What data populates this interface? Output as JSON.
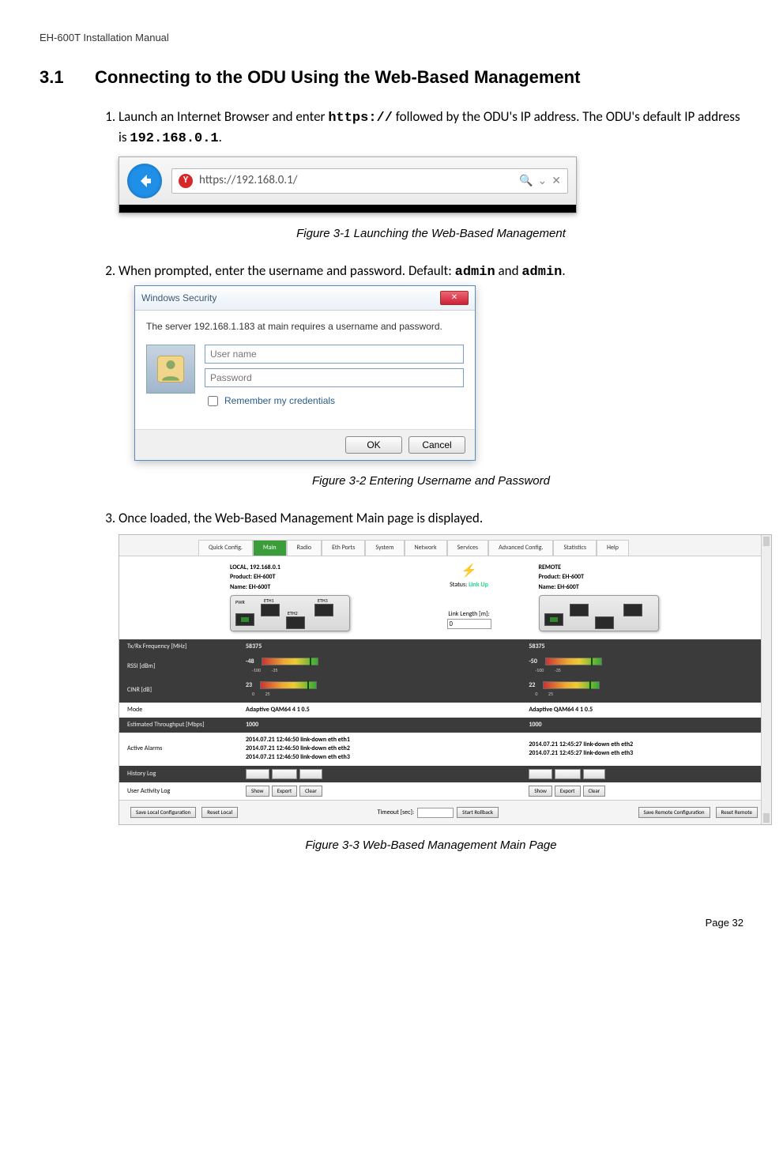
{
  "header": "EH-600T Installation Manual",
  "section": {
    "num": "3.1",
    "title": "Connecting to the ODU Using the Web-Based Management"
  },
  "steps": {
    "s1a": "Launch an Internet Browser and enter ",
    "s1_code1": "https://",
    "s1b": " followed by the ODU's IP address. The ODU's default IP address is ",
    "s1_code2": "192.168.0.1",
    "s1c": ".",
    "s2a": "When prompted, enter the username and password. Default: ",
    "s2_code1": "admin",
    "s2b": " and ",
    "s2_code2": "admin",
    "s2c": ".",
    "s3": "Once loaded, the Web-Based Management Main page is displayed."
  },
  "captions": {
    "f1": "Figure 3-1 Launching the Web-Based Management",
    "f2": "Figure 3-2 Entering Username and Password",
    "f3": "Figure 3-3 Web-Based Management Main Page"
  },
  "browser": {
    "url": "https://192.168.0.1/",
    "search_hint": "⌄",
    "close": "✕",
    "mag": "🔍"
  },
  "dialog": {
    "title": "Windows Security",
    "msg": "The server 192.168.1.183 at main requires a username and password.",
    "user_ph": "User name",
    "pass_ph": "Password",
    "remember": "Remember my credentials",
    "ok": "OK",
    "cancel": "Cancel"
  },
  "mgmt": {
    "tabs": [
      "Quick Config.",
      "Main",
      "Radio",
      "Eth Ports",
      "System",
      "Network",
      "Services",
      "Advanced Config.",
      "Statistics",
      "Help"
    ],
    "local": {
      "heading": "LOCAL, 192.168.0.1",
      "product": "Product: EH-600T",
      "name": "Name: EH-600T"
    },
    "remote": {
      "heading": "REMOTE",
      "product": "Product: EH-600T",
      "name": "Name: EH-600T"
    },
    "status_label": "Status:",
    "status_value": "Link Up",
    "link_len": "Link Length [m]:",
    "link_len_val": "0",
    "rows": [
      {
        "label": "Tx/Rx Frequency [MHz]",
        "l": "58375",
        "r": "58375",
        "dark": true
      },
      {
        "label": "RSSI [dBm]",
        "l": "-48",
        "r": "-50",
        "dark": true,
        "gauge": true,
        "gmin": "-100",
        "gmax": "-35"
      },
      {
        "label": "CINR [dB]",
        "l": "23",
        "r": "22",
        "dark": true,
        "gauge": true,
        "gmin": "0",
        "gmax": "25"
      },
      {
        "label": "Mode",
        "l": "Adaptive QAM64 4 1 0.5",
        "r": "Adaptive QAM64 4 1 0.5",
        "dark": false
      },
      {
        "label": "Estimated Throughput [Mbps]",
        "l": "1000",
        "r": "1000",
        "dark": true
      },
      {
        "label": "Active Alarms",
        "l": "2014.07.21 12:46:50 link-down eth eth1\n2014.07.21 12:46:50 link-down eth eth2\n2014.07.21 12:46:50 link-down eth eth3",
        "r": "2014.07.21 12:45:27 link-down eth eth2\n2014.07.21 12:45:27 link-down eth eth3",
        "dark": false
      },
      {
        "label": "History Log",
        "buttons": true,
        "dark": true
      },
      {
        "label": "User Activity Log",
        "buttons": true,
        "dark": false
      }
    ],
    "btns": {
      "show": "Show",
      "export": "Export",
      "clear": "Clear"
    },
    "footer": {
      "save_local": "Save Local Configuration",
      "reset_local": "Reset Local",
      "timeout": "Timeout [sec]:",
      "rollback": "Start Rollback",
      "save_remote": "Save Remote Configuration",
      "reset_remote": "Reset Remote"
    },
    "ports": {
      "pwr": "PWR",
      "e1": "ETH1",
      "e2": "ETH2",
      "e3": "ETH3"
    }
  },
  "footer": "Page 32"
}
